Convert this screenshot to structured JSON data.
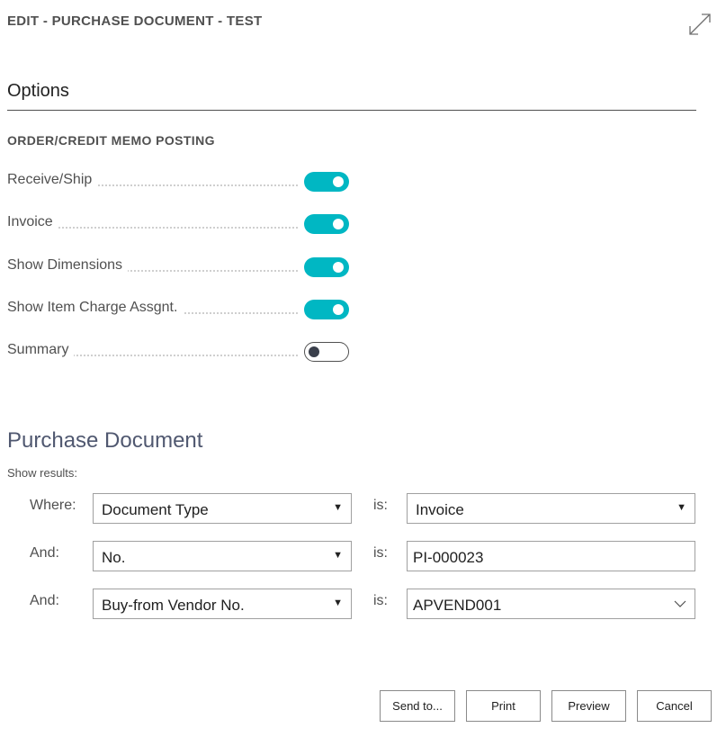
{
  "dialog": {
    "title": "EDIT - PURCHASE DOCUMENT - TEST"
  },
  "options": {
    "heading": "Options",
    "group_caption": "ORDER/CREDIT MEMO POSTING",
    "rows": [
      {
        "label": "Receive/Ship",
        "value": true
      },
      {
        "label": "Invoice",
        "value": true
      },
      {
        "label": "Show Dimensions",
        "value": true
      },
      {
        "label": "Show Item Charge Assgnt.",
        "value": true
      },
      {
        "label": "Summary",
        "value": false
      }
    ]
  },
  "purchase_document": {
    "heading": "Purchase Document",
    "show_results": "Show results:",
    "filters": [
      {
        "connector": "Where:",
        "field": "Document Type",
        "op": "is:",
        "value": "Invoice"
      },
      {
        "connector": "And:",
        "field": "No.",
        "op": "is:",
        "value": "PI-000023"
      },
      {
        "connector": "And:",
        "field": "Buy-from Vendor No.",
        "op": "is:",
        "value": "APVEND001"
      }
    ]
  },
  "buttons": {
    "send_to": "Send to...",
    "print": "Print",
    "preview": "Preview",
    "cancel": "Cancel"
  },
  "colors": {
    "toggle_on": "#00b7c3",
    "text": "#505050"
  },
  "icons": {
    "expand": "expand-diagonal-icon",
    "dropdown": "triangle-down",
    "lookup": "chevron-down-icon"
  }
}
